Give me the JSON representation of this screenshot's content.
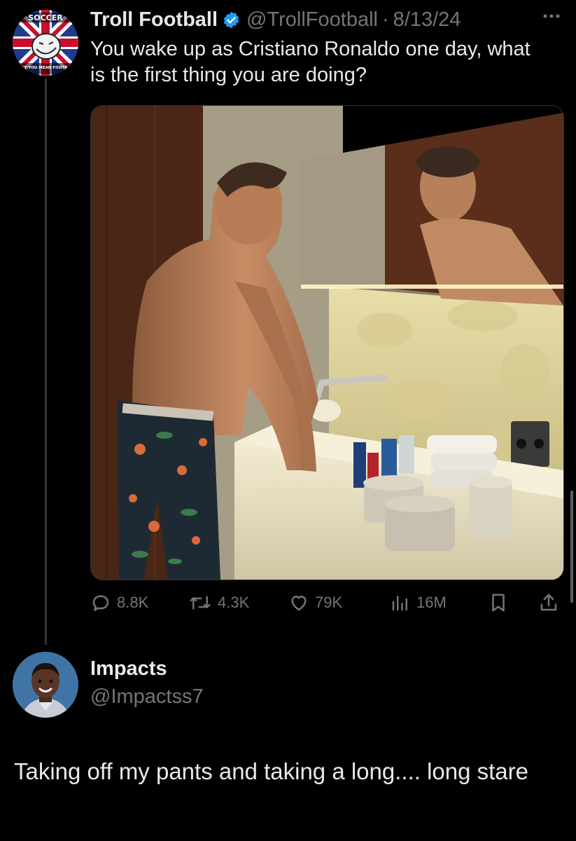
{
  "tweet": {
    "author_name": "Troll Football",
    "handle": "@TrollFootball",
    "separator": "·",
    "date": "8/13/24",
    "text": "You wake up as Cristiano Ronaldo one day, what is the first thing you are doing?",
    "avatar_text_top": "SOCCER",
    "avatar_text_bottom": "DON'T YOU MEAN FOOTBALL?",
    "stats": {
      "replies": "8.8K",
      "retweets": "4.3K",
      "likes": "79K",
      "views": "16M"
    }
  },
  "reply": {
    "author_name": "Impacts",
    "handle": "@Impactss7",
    "text": "Taking off my pants and taking a long.... long stare"
  },
  "icons": {
    "verified": "verified-badge-icon",
    "more": "more-icon",
    "reply": "reply-icon",
    "retweet": "retweet-icon",
    "like": "heart-icon",
    "views": "views-icon",
    "bookmark": "bookmark-icon",
    "share": "share-icon"
  },
  "colors": {
    "background": "#000000",
    "text_primary": "#e7e9ea",
    "text_secondary": "#71767b",
    "verified_blue": "#1d9bf0"
  }
}
